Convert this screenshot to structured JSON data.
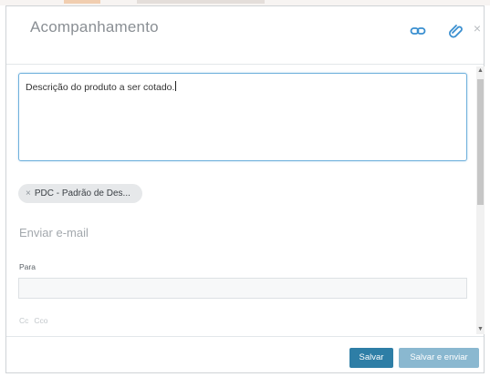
{
  "modal": {
    "title": "Acompanhamento",
    "header_icons": [
      "link-icon",
      "paperclip-icon",
      "close-icon"
    ],
    "close_glyph": "×"
  },
  "description": {
    "value": "Descrição do produto a ser cotado."
  },
  "chip": {
    "remove_glyph": "×",
    "label": "PDC - Padrão de Des..."
  },
  "email": {
    "section_title": "Enviar e-mail",
    "to_label": "Para",
    "to_value": "",
    "cc_label": "Cc",
    "cco_label": "Cco"
  },
  "footer": {
    "save_label": "Salvar",
    "save_send_label": "Salvar e enviar"
  },
  "scrollbar": {
    "up_glyph": "▲",
    "down_glyph": "▼"
  },
  "colors": {
    "accent": "#2e7ea6",
    "accent_light": "#8ab8d0",
    "icon_blue": "#3a8fd0",
    "focus_border": "#6fb0dc"
  }
}
